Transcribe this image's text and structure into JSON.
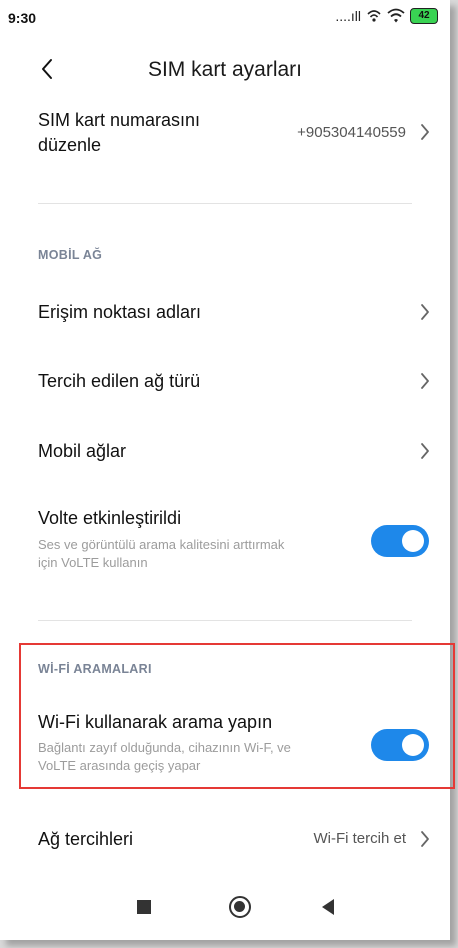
{
  "status_bar": {
    "time": "9:30",
    "signal_text": "....ıll",
    "battery": "42"
  },
  "header": {
    "title": "SIM kart ayarları"
  },
  "sim_number_row": {
    "label_line1": "SIM kart numarasını",
    "label_line2": "düzenle",
    "value": "+905304140559"
  },
  "mobile_network": {
    "section_title": "MOBİL AĞ",
    "items": [
      {
        "label": "Erişim noktası adları"
      },
      {
        "label": "Tercih edilen ağ türü"
      },
      {
        "label": "Mobil ağlar"
      }
    ],
    "volte": {
      "label": "Volte etkinleştirildi",
      "description_line1": "Ses ve görüntülü arama kalitesini arttırmak",
      "description_line2": "için VoLTE kullanın",
      "enabled": true
    }
  },
  "wifi_calling": {
    "section_title": "Wİ-Fİ ARAMALARI",
    "label": "Wi-Fi kullanarak arama yapın",
    "description_line1": "Bağlantı zayıf olduğunda, cihazının Wi-F, ve",
    "description_line2": "VoLTE arasında geçiş yapar",
    "enabled": true
  },
  "network_pref": {
    "label": "Ağ tercihleri",
    "value": "Wi-Fi tercih et"
  },
  "colors": {
    "accent": "#1e88ea",
    "highlight": "#e53935",
    "section_header": "#7a8496"
  }
}
